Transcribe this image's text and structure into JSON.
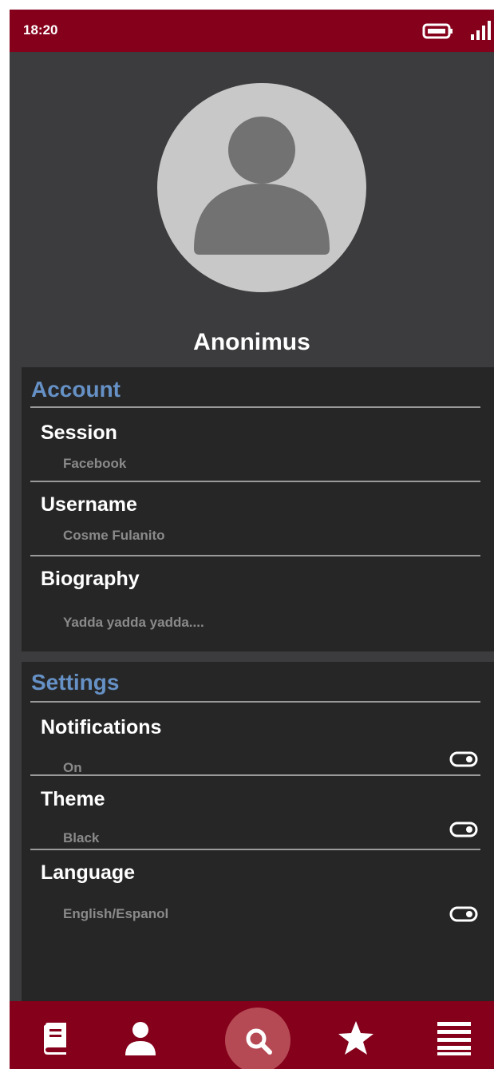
{
  "status_bar": {
    "time": "18:20"
  },
  "profile": {
    "name": "Anonimus"
  },
  "account": {
    "title": "Account",
    "items": [
      {
        "label": "Session",
        "value": "Facebook"
      },
      {
        "label": "Username",
        "value": "Cosme Fulanito"
      },
      {
        "label": "Biography",
        "value": "Yadda yadda yadda...."
      }
    ]
  },
  "settings": {
    "title": "Settings",
    "items": [
      {
        "label": "Notifications",
        "value": "On"
      },
      {
        "label": "Theme",
        "value": "Black"
      },
      {
        "label": "Language",
        "value": "English/Espanol"
      }
    ]
  },
  "bottom_nav": {
    "items": [
      {
        "icon": "book-icon"
      },
      {
        "icon": "user-icon"
      },
      {
        "icon": "search-icon",
        "active": true
      },
      {
        "icon": "star-icon"
      },
      {
        "icon": "menu-icon"
      }
    ]
  },
  "colors": {
    "accent": "#85001a",
    "section_title": "#6691c6",
    "background": "#3c3b3d",
    "panel": "#262626"
  }
}
